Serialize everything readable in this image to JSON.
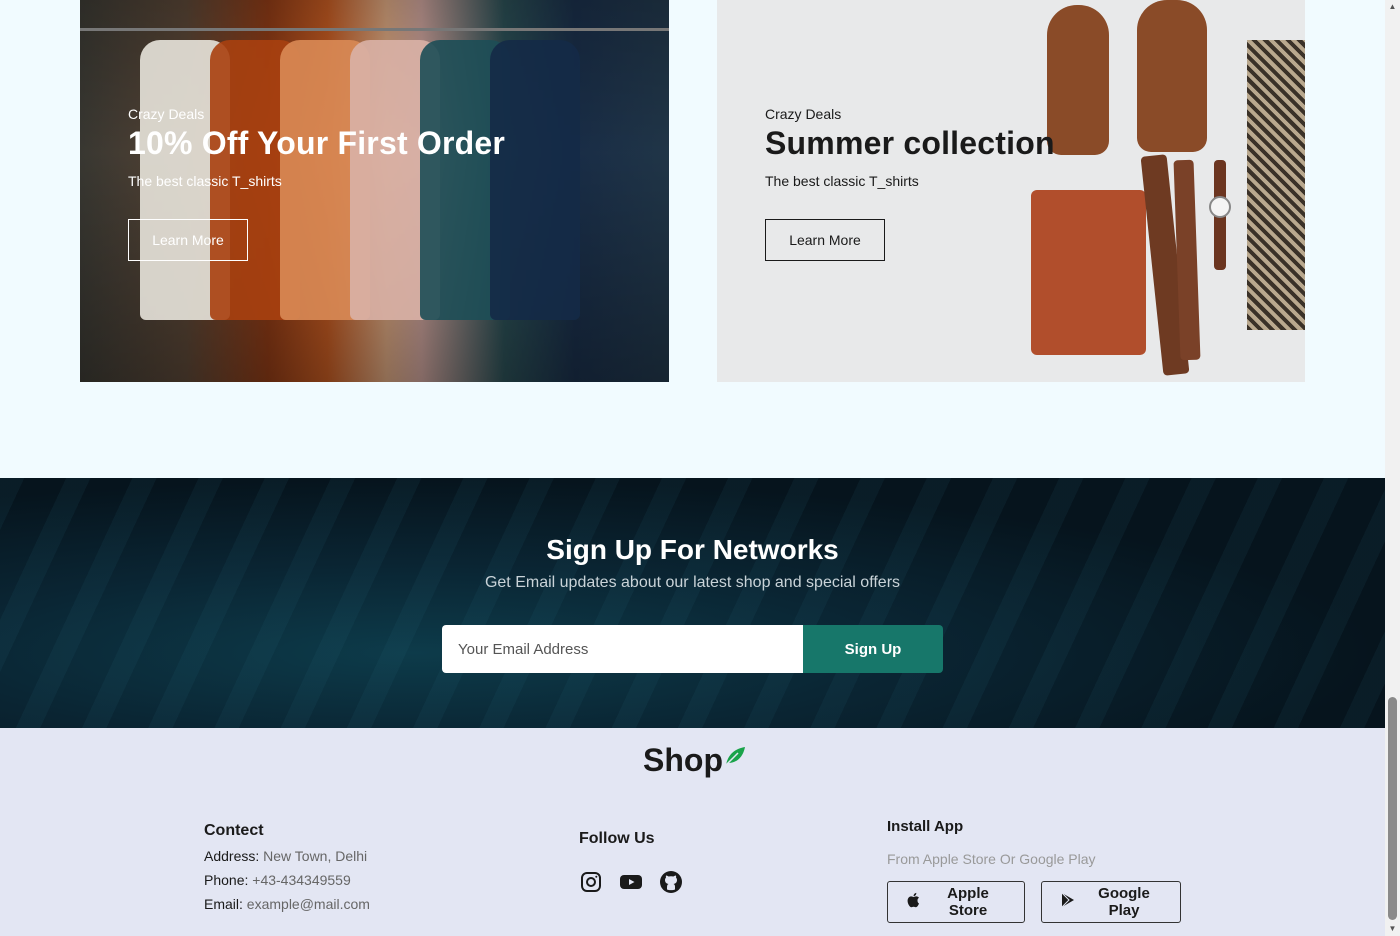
{
  "banners": [
    {
      "small": "Crazy Deals",
      "title": "10% Off Your First Order",
      "subtitle": "The best classic T_shirts",
      "button": "Learn More"
    },
    {
      "small": "Crazy Deals",
      "title": "Summer collection",
      "subtitle": "The best classic T_shirts",
      "button": "Learn More"
    }
  ],
  "newsletter": {
    "title": "Sign Up For Networks",
    "subtitle": "Get Email updates about our latest shop and special offers",
    "placeholder": "Your Email Address",
    "button": "Sign Up"
  },
  "footer": {
    "logo": "Shop",
    "contact": {
      "title": "Contect",
      "address_label": "Address:",
      "address": "New Town, Delhi",
      "phone_label": "Phone:",
      "phone": "+43-434349559",
      "email_label": "Email:",
      "email": "example@mail.com"
    },
    "follow": {
      "title": "Follow Us",
      "icons": [
        "instagram-icon",
        "youtube-icon",
        "github-icon"
      ]
    },
    "app": {
      "title": "Install App",
      "subtitle": "From Apple Store Or Google Play",
      "apple": "Apple Store",
      "google": "Google Play"
    }
  },
  "colors": {
    "page_bg": "#f1fbff",
    "accent": "#17776a",
    "footer_bg": "#e3e6f3",
    "leaf": "#1aa34a"
  }
}
